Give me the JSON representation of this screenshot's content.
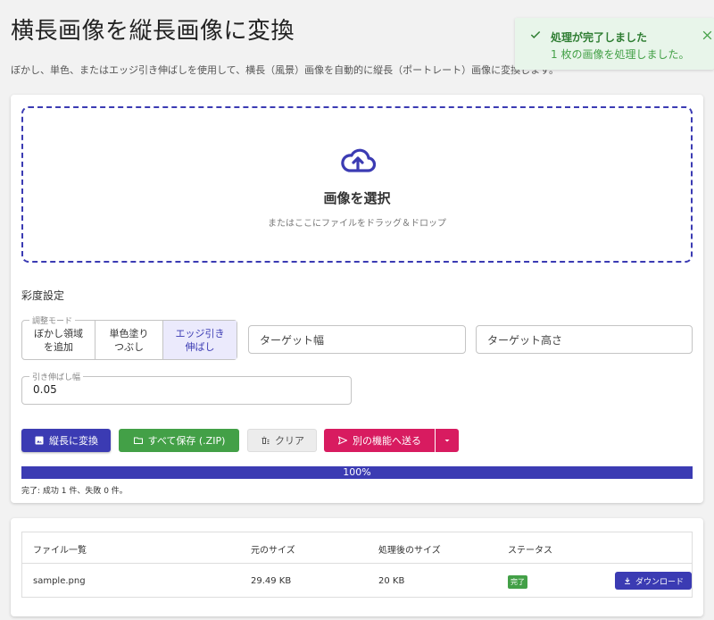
{
  "page": {
    "title": "横長画像を縦長画像に変換",
    "description": "ぼかし、単色、またはエッジ引き伸ばしを使用して、横長（風景）画像を自動的に縦長（ポートレート）画像に変換します。"
  },
  "toast": {
    "title": "処理が完了しました",
    "message": "1 枚の画像を処理しました。"
  },
  "dropzone": {
    "select_label": "画像を選択",
    "hint": "またはここにファイルをドラッグ＆ドロップ"
  },
  "settings": {
    "section_title": "彩度設定",
    "mode_legend": "調整モード",
    "modes": [
      {
        "label": "ぼかし領域を追加",
        "line1": "ぼかし領域",
        "line2": "を追加",
        "active": false
      },
      {
        "label": "単色塗りつぶし",
        "line1": "単色塗り",
        "line2": "つぶし",
        "active": false
      },
      {
        "label": "エッジ引き伸ばし",
        "line1": "エッジ引き",
        "line2": "伸ばし",
        "active": true
      }
    ],
    "target_width_placeholder": "ターゲット幅",
    "target_height_placeholder": "ターゲット高さ",
    "stretch_legend": "引き伸ばし幅",
    "stretch_value": "0.05"
  },
  "actions": {
    "convert": "縦長に変換",
    "save_all": "すべて保存 (.ZIP)",
    "clear": "クリア",
    "send": "別の機能へ送る"
  },
  "progress": {
    "percent_label": "100%",
    "value": 1.0,
    "status_text": "完了: 成功 1 件、失敗 0 件。"
  },
  "table": {
    "headers": [
      "ファイル一覧",
      "元のサイズ",
      "処理後のサイズ",
      "ステータス"
    ],
    "rows": [
      {
        "name": "sample.png",
        "original": "29.49 KB",
        "processed": "20 KB",
        "status": "完了",
        "download": "ダウンロード"
      }
    ]
  },
  "colors": {
    "primary": "#3b3bb3",
    "success": "#43a047",
    "accent": "#d81b60"
  }
}
